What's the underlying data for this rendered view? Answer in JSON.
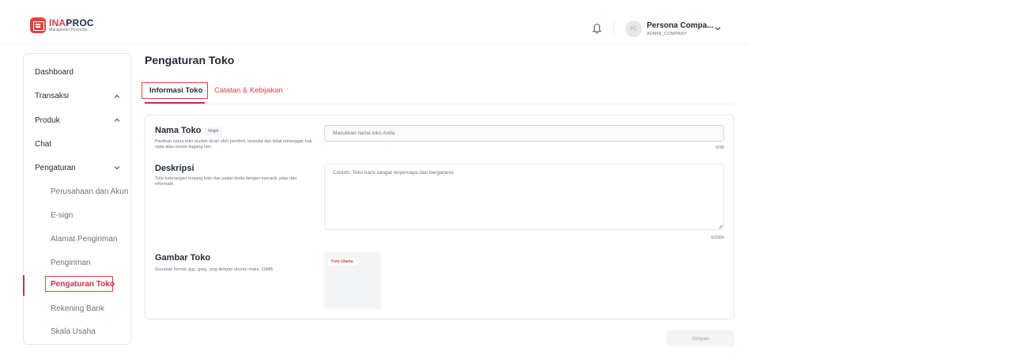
{
  "header": {
    "logo_title_accent": "INA",
    "logo_title_rest": "PROC",
    "logo_subtitle": "Manajemen Penyedia",
    "user_initials": "PC",
    "user_name": "Persona Compa...",
    "user_role": "ADMIN_COMPANY"
  },
  "sidebar": {
    "items": [
      {
        "label": "Dashboard"
      },
      {
        "label": "Transaksi"
      },
      {
        "label": "Produk"
      },
      {
        "label": "Chat"
      },
      {
        "label": "Pengaturan"
      }
    ],
    "sub_items": [
      {
        "label": "Perusahaan dan Akun"
      },
      {
        "label": "E-sign"
      },
      {
        "label": "Alamat Pengiriman"
      },
      {
        "label": "Pengiriman"
      },
      {
        "label": "Pengaturan Toko"
      },
      {
        "label": "Rekening Bank"
      },
      {
        "label": "Skala Usaha"
      }
    ]
  },
  "main": {
    "title": "Pengaturan Toko",
    "tabs": [
      {
        "label": "Informasi Toko"
      },
      {
        "label": "Catatan & Kebijakan"
      }
    ],
    "form": {
      "name": {
        "label": "Nama Toko",
        "badge": "Wajib",
        "help": "Pastikan nama toko mudah dicari oleh pembeli, tersedia dan tidak melanggar hak cipta atau merek dagang lain.",
        "placeholder": "Masukkan nama toko Anda",
        "counter": "0/30"
      },
      "description": {
        "label": "Deskripsi",
        "help": "Tulis keterangan tentang toko dan jualan Anda dengan menarik, jelas dan informatif.",
        "placeholder": "Contoh: Toko kami sangat terpercaya dan bergaransi",
        "counter": "0/2000"
      },
      "image": {
        "label": "Gambar Toko",
        "help": "Gunakan format .jpg, .jpeg, .png dengan ukuran maks. 10MB.",
        "tag": "Foto Utama"
      }
    },
    "save_label": "Simpan"
  },
  "colors": {
    "accent": "#c2344a",
    "highlight": "#e0443f"
  }
}
